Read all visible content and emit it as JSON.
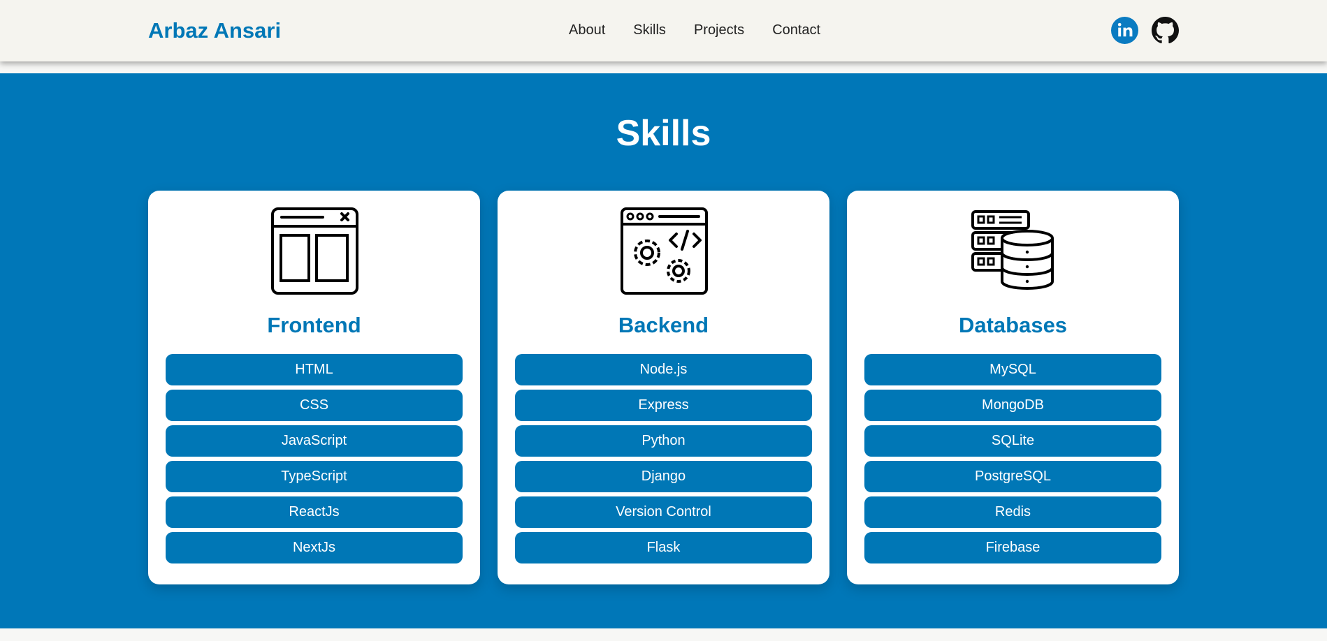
{
  "nav": {
    "brand": "Arbaz Ansari",
    "links": [
      "About",
      "Skills",
      "Projects",
      "Contact"
    ],
    "social": [
      {
        "icon": "linkedin-icon",
        "color": "#0a7bc1"
      },
      {
        "icon": "github-icon",
        "color": "#111111"
      }
    ]
  },
  "skills": {
    "title": "Skills",
    "categories": [
      {
        "name": "Frontend",
        "icon": "browser-window-icon",
        "items": [
          "HTML",
          "CSS",
          "JavaScript",
          "TypeScript",
          "ReactJs",
          "NextJs"
        ]
      },
      {
        "name": "Backend",
        "icon": "code-settings-icon",
        "items": [
          "Node.js",
          "Express",
          "Python",
          "Django",
          "Version Control",
          "Flask"
        ]
      },
      {
        "name": "Databases",
        "icon": "database-server-icon",
        "items": [
          "MySQL",
          "MongoDB",
          "SQLite",
          "PostgreSQL",
          "Redis",
          "Firebase"
        ]
      }
    ]
  },
  "colors": {
    "accent": "#0077b6",
    "section_bg": "#0077b8",
    "nav_bg": "#f5f4ef"
  }
}
